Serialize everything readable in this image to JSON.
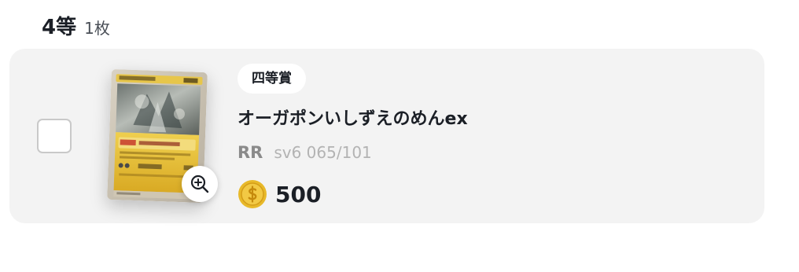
{
  "header": {
    "prize_rank": "4等",
    "prize_count": "1枚"
  },
  "item": {
    "badge": "四等賞",
    "card_name": "オーガポンいしずえのめんex",
    "rarity": "RR",
    "set_code": "sv6 065/101",
    "price": "500",
    "checked": false,
    "icons": {
      "zoom": "zoom-in-icon",
      "coin": "coin-icon",
      "checkbox": "checkbox-icon"
    }
  },
  "colors": {
    "card_background": "#f3f3f3",
    "text_primary": "#1b1f26",
    "rarity_text": "#8a8a8a",
    "set_code_text": "#b3b3b3",
    "coin_gold": "#e8b92a"
  }
}
